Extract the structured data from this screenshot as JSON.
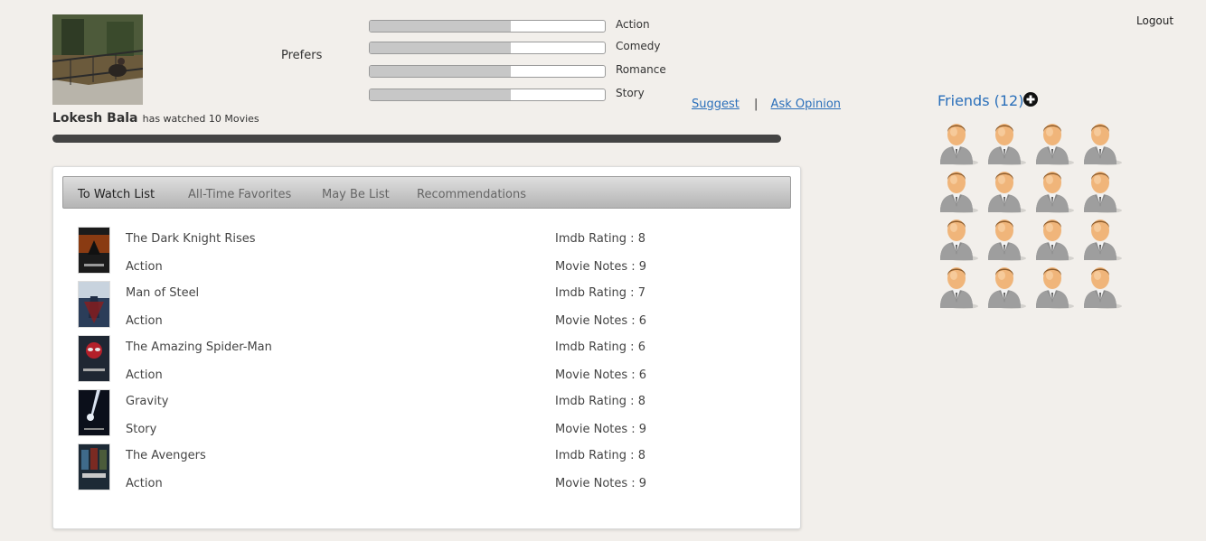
{
  "user": {
    "name": "Lokesh Bala",
    "watched_text": "has watched 10 Movies",
    "watched_progress": 1.0
  },
  "preferences": {
    "label": "Prefers",
    "items": [
      {
        "label": "Action",
        "level": 0.6
      },
      {
        "label": "Comedy",
        "level": 0.6
      },
      {
        "label": "Romance",
        "level": 0.6
      },
      {
        "label": "Story",
        "level": 0.6
      }
    ]
  },
  "links": {
    "suggest": "Suggest",
    "separator": "|",
    "ask_opinion": "Ask Opinion",
    "logout": "Logout"
  },
  "tabs": [
    "To Watch List",
    "All-Time Favorites",
    "May Be List",
    "Recommendations"
  ],
  "active_tab": 0,
  "movies": [
    {
      "title": "The Dark Knight Rises",
      "genre": "Action",
      "imdb": "Imdb Rating : 8",
      "notes": "Movie Notes : 9"
    },
    {
      "title": "Man of Steel",
      "genre": "Action",
      "imdb": "Imdb Rating : 7",
      "notes": "Movie Notes : 6"
    },
    {
      "title": "The Amazing Spider-Man",
      "genre": "Action",
      "imdb": "Imdb Rating : 6",
      "notes": "Movie Notes : 6"
    },
    {
      "title": "Gravity",
      "genre": "Story",
      "imdb": "Imdb Rating : 8",
      "notes": "Movie Notes : 9"
    },
    {
      "title": "The Avengers",
      "genre": "Action",
      "imdb": "Imdb Rating : 8",
      "notes": "Movie Notes : 9"
    }
  ],
  "friends": {
    "header": "Friends (12)",
    "avatars_shown": 16,
    "add_icon": "plus-circle-icon"
  },
  "colors": {
    "link": "#2a6fba",
    "background": "#f2efeb",
    "progress": "#444444",
    "pref_fill": "#c7c7c7"
  }
}
